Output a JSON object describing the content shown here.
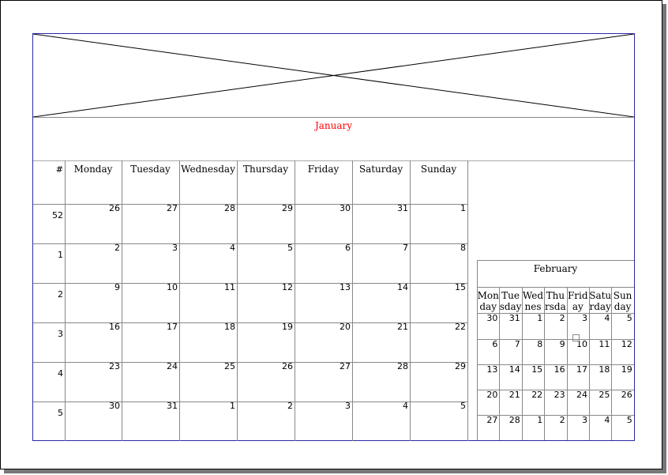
{
  "main_month": {
    "title": "January",
    "headers": [
      "#",
      "Monday",
      "Tuesday",
      "Wednesday",
      "Thursday",
      "Friday",
      "Saturday",
      "Sunday"
    ],
    "rows": [
      {
        "week": "52",
        "days": [
          "26",
          "27",
          "28",
          "29",
          "30",
          "31",
          "1"
        ]
      },
      {
        "week": "1",
        "days": [
          "2",
          "3",
          "4",
          "5",
          "6",
          "7",
          "8"
        ]
      },
      {
        "week": "2",
        "days": [
          "9",
          "10",
          "11",
          "12",
          "13",
          "14",
          "15"
        ]
      },
      {
        "week": "3",
        "days": [
          "16",
          "17",
          "18",
          "19",
          "20",
          "21",
          "22"
        ]
      },
      {
        "week": "4",
        "days": [
          "23",
          "24",
          "25",
          "26",
          "27",
          "28",
          "29"
        ]
      },
      {
        "week": "5",
        "days": [
          "30",
          "31",
          "1",
          "2",
          "3",
          "4",
          "5"
        ]
      }
    ]
  },
  "mini_month": {
    "title": "February",
    "headers": [
      "Monday",
      "Tuesday",
      "Wednesday",
      "Thursday",
      "Friday",
      "Saturday",
      "Sunday"
    ],
    "rows": [
      [
        "30",
        "31",
        "1",
        "2",
        "3",
        "4",
        "5"
      ],
      [
        "6",
        "7",
        "8",
        "9",
        "10",
        "11",
        "12"
      ],
      [
        "13",
        "14",
        "15",
        "16",
        "17",
        "18",
        "19"
      ],
      [
        "20",
        "21",
        "22",
        "23",
        "24",
        "25",
        "26"
      ],
      [
        "27",
        "28",
        "1",
        "2",
        "3",
        "4",
        "5"
      ]
    ]
  },
  "colors": {
    "frame": "#2a2aa8",
    "month_title": "#ff0000",
    "grid": "#888888"
  },
  "icons": {
    "banner": "image-placeholder-icon",
    "broken": "broken-image-icon"
  }
}
